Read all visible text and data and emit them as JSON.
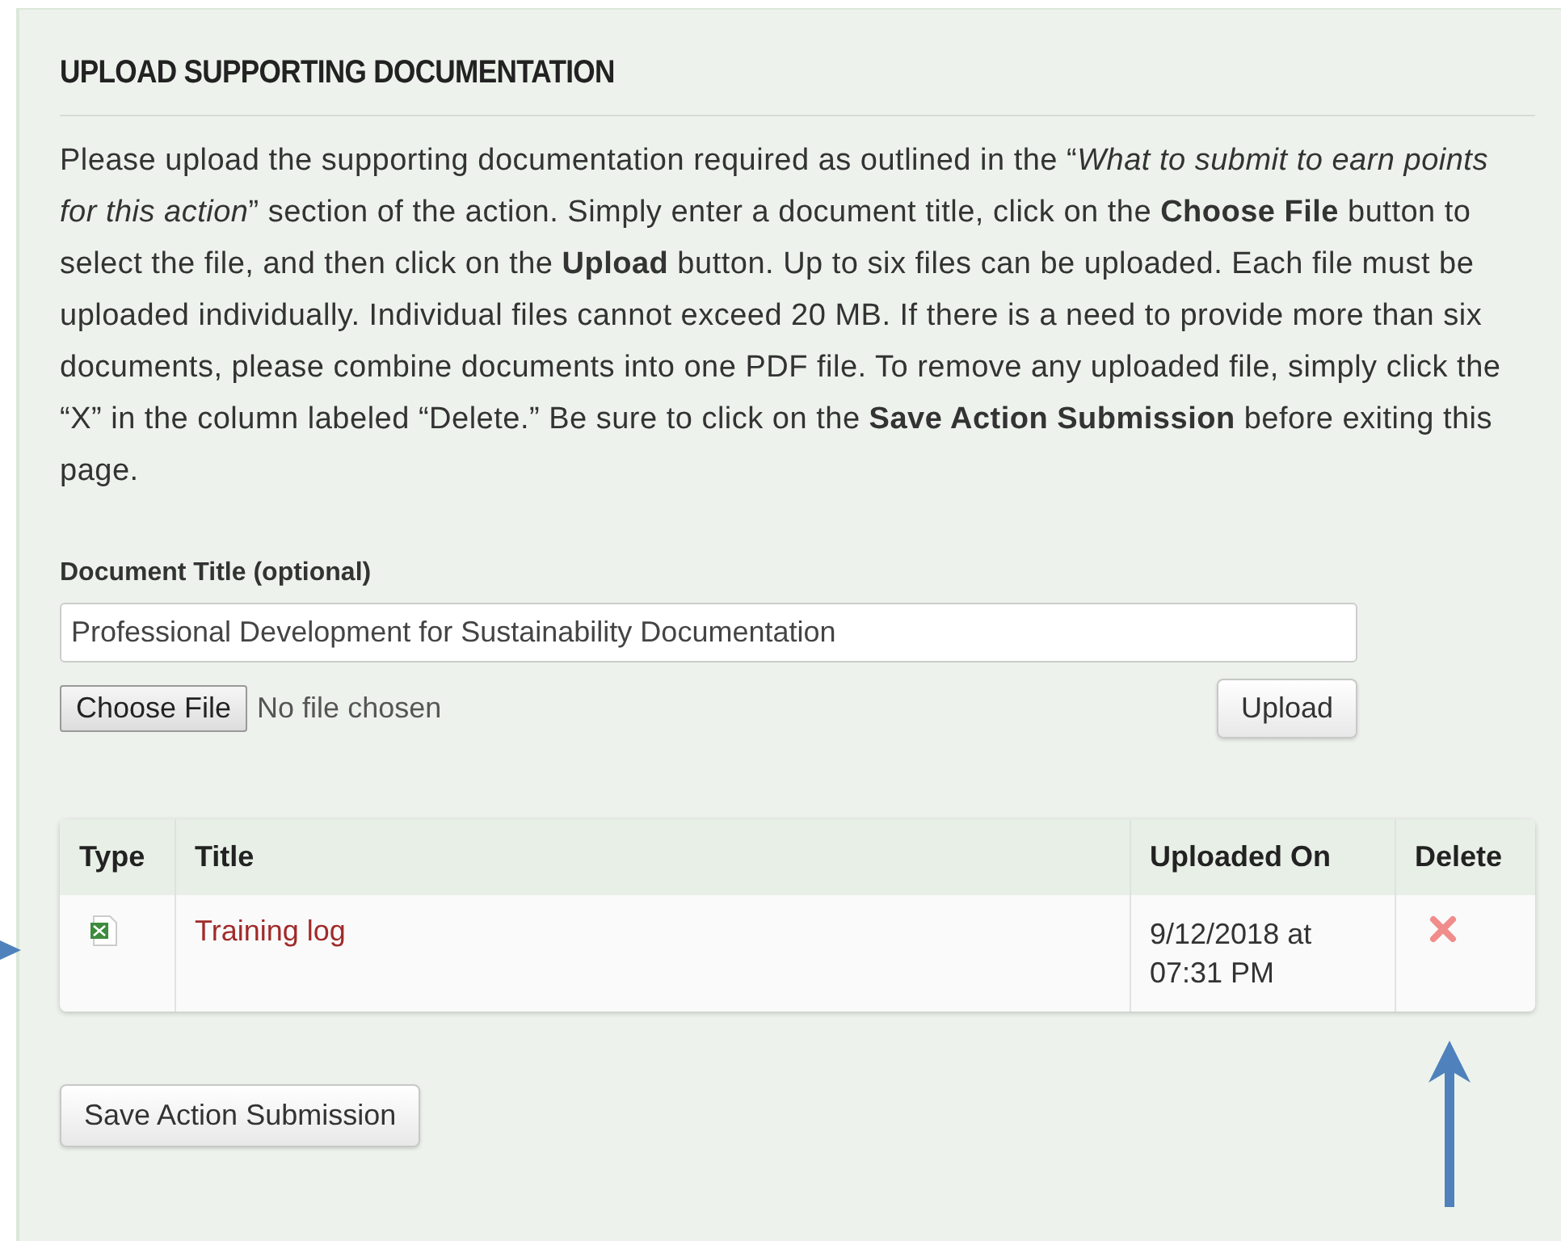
{
  "section": {
    "title": "UPLOAD SUPPORTING DOCUMENTATION",
    "instructions": "Please upload the supporting documentation required as outlined in the “*What to submit to earn points for this action*” section of the action. Simply enter a document title, click on the **Choose File** button to select the file, and then click on the **Upload** button. Up to six files can be uploaded. Each file must be uploaded individually. Individual files cannot exceed 20 MB. If there is a need to provide more than six documents, please combine documents into one PDF file. To remove any uploaded file, simply click the “X” in the column labeled “Delete.” Be sure to click on the **Save Action Submission** before exiting this page."
  },
  "form": {
    "label": "Document Title (optional)",
    "value": "Professional Development for Sustainability Documentation",
    "file_button": "Choose File",
    "file_status": "No file chosen",
    "upload_button": "Upload"
  },
  "table": {
    "columns": [
      "Type",
      "Title",
      "Uploaded On",
      "Delete"
    ],
    "rows": [
      {
        "kind": "spreadsheet",
        "title": "Training log",
        "uploaded_on": "9/12/2018 at 07:31 PM"
      }
    ]
  },
  "save_button": "Save Action Submission"
}
